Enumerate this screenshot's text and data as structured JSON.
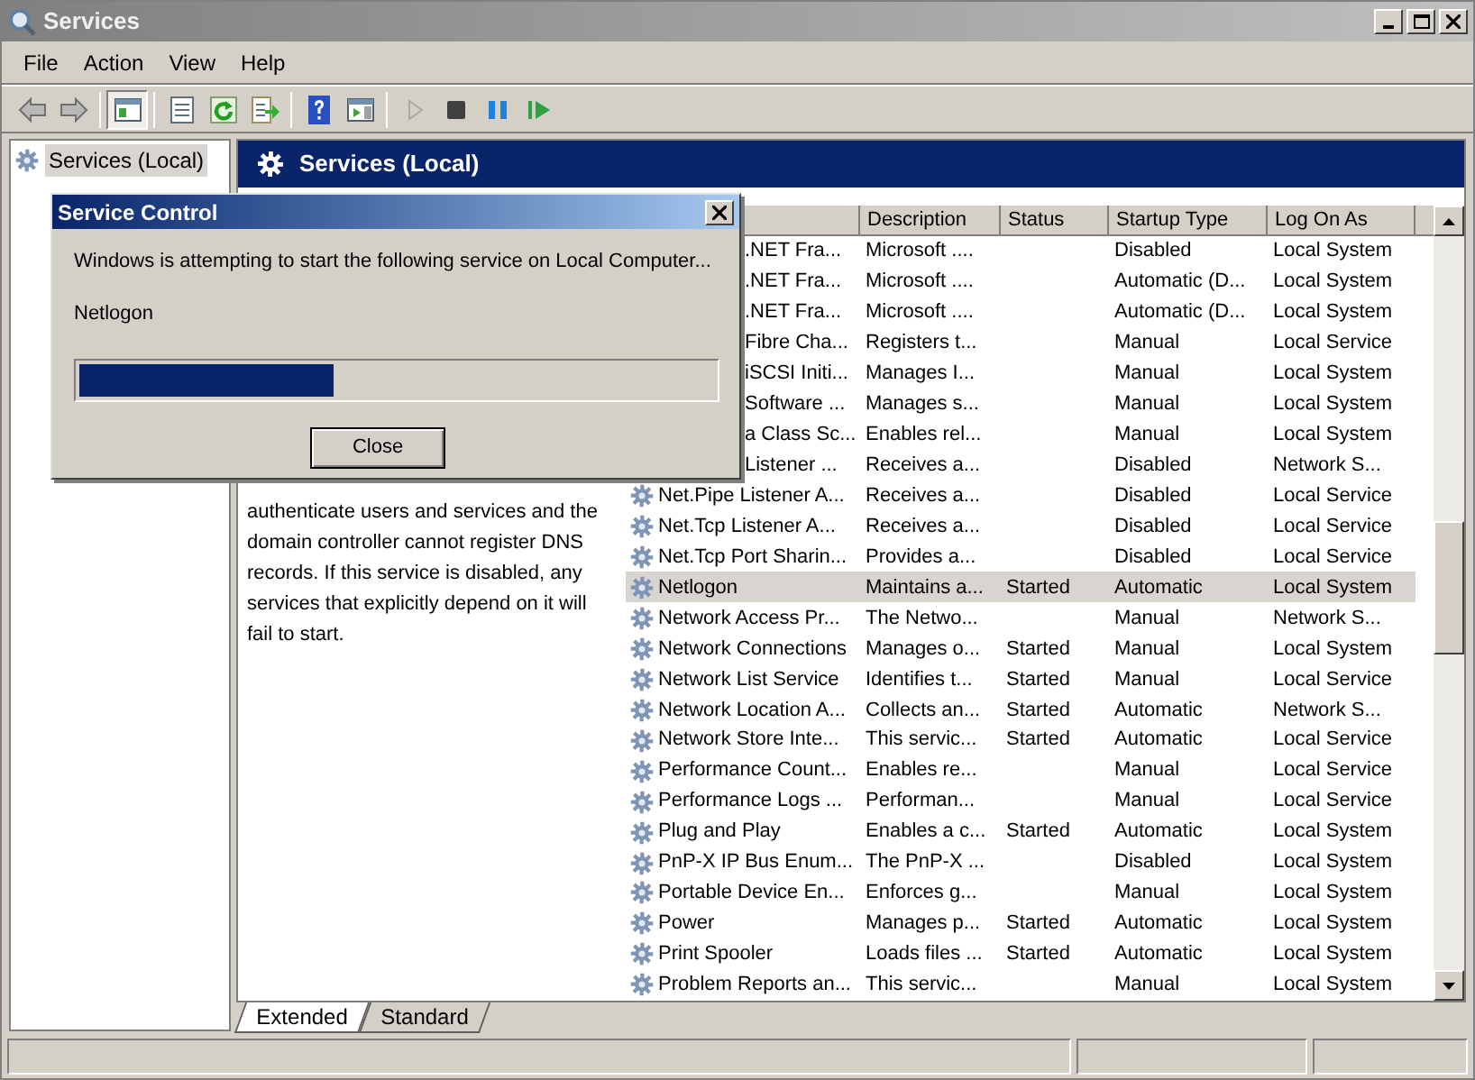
{
  "window": {
    "title": "Services"
  },
  "menu": [
    "File",
    "Action",
    "View",
    "Help"
  ],
  "toolbar": [
    {
      "items": [
        {
          "kind": "back"
        },
        {
          "kind": "forward"
        }
      ]
    },
    {
      "items": [
        {
          "kind": "console_tree",
          "pressed": true
        }
      ]
    },
    {
      "items": [
        {
          "kind": "properties"
        },
        {
          "kind": "refresh"
        },
        {
          "kind": "export"
        }
      ]
    },
    {
      "items": [
        {
          "kind": "help"
        },
        {
          "kind": "action_pane"
        }
      ]
    },
    {
      "items": [
        {
          "kind": "start",
          "disabled": true
        },
        {
          "kind": "stop"
        },
        {
          "kind": "pause"
        },
        {
          "kind": "restart"
        }
      ]
    }
  ],
  "tree": {
    "items": [
      {
        "label": "Services (Local)",
        "selected": true
      }
    ]
  },
  "pane_header": {
    "title": "Services (Local)"
  },
  "description": "authenticate users and services and the domain controller cannot register DNS records. If this service is disabled, any services that explicitly depend on it will fail to start.",
  "table": {
    "columns": [
      "Description",
      "Status",
      "Startup Type",
      "Log On As"
    ],
    "rows": [
      {
        "name": ".NET Fra...",
        "covered": true,
        "description": "Microsoft ....",
        "startup_type": "Disabled",
        "log_on_as": "Local System",
        "selected": false
      },
      {
        "name": ".NET Fra...",
        "covered": true,
        "description": "Microsoft ....",
        "startup_type": "Automatic (D...",
        "log_on_as": "Local System",
        "selected": false
      },
      {
        "name": ".NET Fra...",
        "covered": true,
        "description": "Microsoft ....",
        "startup_type": "Automatic (D...",
        "log_on_as": "Local System",
        "selected": false
      },
      {
        "name": "Fibre Cha...",
        "covered": true,
        "description": "Registers t...",
        "startup_type": "Manual",
        "log_on_as": "Local Service",
        "selected": false
      },
      {
        "name": "iSCSI Initi...",
        "covered": true,
        "description": "Manages I...",
        "startup_type": "Manual",
        "log_on_as": "Local System",
        "selected": false
      },
      {
        "name": "Software ...",
        "covered": true,
        "description": "Manages s...",
        "startup_type": "Manual",
        "log_on_as": "Local System",
        "selected": false
      },
      {
        "name": "a Class Sc...",
        "covered": true,
        "description": "Enables rel...",
        "startup_type": "Manual",
        "log_on_as": "Local System",
        "selected": false
      },
      {
        "name": "Listener ...",
        "covered": true,
        "description": "Receives a...",
        "startup_type": "Disabled",
        "log_on_as": "Network S...",
        "selected": false
      },
      {
        "name": "Net.Pipe Listener A...",
        "covered": false,
        "description": "Receives a...",
        "startup_type": "Disabled",
        "log_on_as": "Local Service",
        "selected": false
      },
      {
        "name": "Net.Tcp Listener A...",
        "covered": false,
        "description": "Receives a...",
        "startup_type": "Disabled",
        "log_on_as": "Local Service",
        "selected": false
      },
      {
        "name": "Net.Tcp Port Sharin...",
        "covered": false,
        "description": "Provides a...",
        "startup_type": "Disabled",
        "log_on_as": "Local Service",
        "selected": false
      },
      {
        "name": "Netlogon",
        "covered": false,
        "description": "Maintains a...",
        "status": "Started",
        "startup_type": "Automatic",
        "log_on_as": "Local System",
        "selected": true
      },
      {
        "name": "Network Access Pr...",
        "covered": false,
        "description": "The Netwo...",
        "startup_type": "Manual",
        "log_on_as": "Network S...",
        "selected": false
      },
      {
        "name": "Network Connections",
        "covered": false,
        "description": "Manages o...",
        "status": "Started",
        "startup_type": "Manual",
        "log_on_as": "Local System",
        "selected": false
      },
      {
        "name": "Network List Service",
        "covered": false,
        "description": "Identifies t...",
        "status": "Started",
        "startup_type": "Manual",
        "log_on_as": "Local Service",
        "selected": false
      },
      {
        "name": "Network Location A...",
        "covered": false,
        "description": "Collects an...",
        "status": "Started",
        "startup_type": "Automatic",
        "log_on_as": "Network S...",
        "selected": false
      },
      {
        "name": "Network Store Inte...",
        "covered": false,
        "description": "This servic...",
        "status": "Started",
        "startup_type": "Automatic",
        "log_on_as": "Local Service",
        "selected": false
      },
      {
        "name": "Performance Count...",
        "covered": false,
        "description": "Enables re...",
        "startup_type": "Manual",
        "log_on_as": "Local Service",
        "selected": false
      },
      {
        "name": "Performance Logs ...",
        "covered": false,
        "description": "Performan...",
        "startup_type": "Manual",
        "log_on_as": "Local Service",
        "selected": false
      },
      {
        "name": "Plug and Play",
        "covered": false,
        "description": "Enables a c...",
        "status": "Started",
        "startup_type": "Automatic",
        "log_on_as": "Local System",
        "selected": false
      },
      {
        "name": "PnP-X IP Bus Enum...",
        "covered": false,
        "description": "The PnP-X ...",
        "startup_type": "Disabled",
        "log_on_as": "Local System",
        "selected": false
      },
      {
        "name": "Portable Device En...",
        "covered": false,
        "description": "Enforces g...",
        "startup_type": "Manual",
        "log_on_as": "Local System",
        "selected": false
      },
      {
        "name": "Power",
        "covered": false,
        "description": "Manages p...",
        "status": "Started",
        "startup_type": "Automatic",
        "log_on_as": "Local System",
        "selected": false
      },
      {
        "name": "Print Spooler",
        "covered": false,
        "description": "Loads files ...",
        "status": "Started",
        "startup_type": "Automatic",
        "log_on_as": "Local System",
        "selected": false
      },
      {
        "name": "Problem Reports an...",
        "covered": false,
        "description": "This servic...",
        "startup_type": "Manual",
        "log_on_as": "Local System",
        "selected": false
      }
    ]
  },
  "view_tabs": [
    {
      "label": "Extended",
      "selected": true
    },
    {
      "label": "Standard",
      "selected": false
    }
  ],
  "dialog": {
    "title": "Service Control",
    "message": "Windows is attempting to start the following service on Local Computer...",
    "service": "Netlogon",
    "progress": {
      "level": 0.4
    },
    "button": "Close"
  }
}
